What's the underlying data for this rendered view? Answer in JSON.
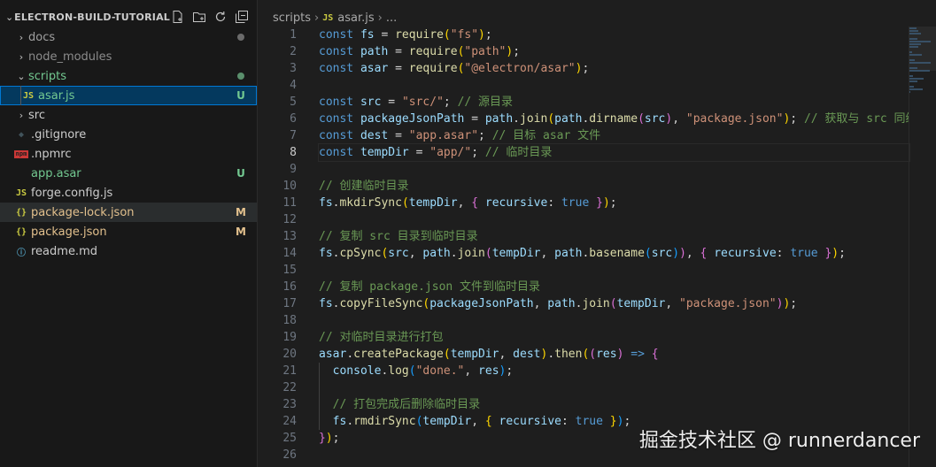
{
  "explorer": {
    "title": "ELECTRON-BUILD-TUTORIAL",
    "actions": [
      "new-file-icon",
      "new-folder-icon",
      "refresh-icon",
      "collapse-all-icon"
    ],
    "items": [
      {
        "label": "docs",
        "kind": "folder",
        "expanded": false,
        "decoration": "dot",
        "color": "#a0a0a0"
      },
      {
        "label": "node_modules",
        "kind": "folder",
        "expanded": false,
        "color": "#8c8c8c"
      },
      {
        "label": "scripts",
        "kind": "folder",
        "expanded": true,
        "decoration": "dot",
        "color": "#73c991"
      },
      {
        "label": "asar.js",
        "kind": "js",
        "badge": "U",
        "color": "#73c991",
        "selected": true
      },
      {
        "label": "src",
        "kind": "folder",
        "expanded": false,
        "color": "#cccccc"
      },
      {
        "label": ".gitignore",
        "kind": "git",
        "color": "#cccccc"
      },
      {
        "label": ".npmrc",
        "kind": "npm",
        "color": "#cccccc"
      },
      {
        "label": "app.asar",
        "kind": "file",
        "badge": "U",
        "color": "#73c991"
      },
      {
        "label": "forge.config.js",
        "kind": "js",
        "color": "#cccccc"
      },
      {
        "label": "package-lock.json",
        "kind": "json",
        "badge": "M",
        "color": "#e2c08d",
        "hover": true
      },
      {
        "label": "package.json",
        "kind": "json",
        "badge": "M",
        "color": "#e2c08d"
      },
      {
        "label": "readme.md",
        "kind": "info",
        "color": "#cccccc"
      }
    ]
  },
  "breadcrumb": {
    "folder": "scripts",
    "file_icon": "JS",
    "file": "asar.js",
    "tail": "..."
  },
  "editor": {
    "active_line": 8,
    "lines": [
      [
        [
          "t-kw",
          "const"
        ],
        [
          "t-p",
          " "
        ],
        [
          "t-var",
          "fs"
        ],
        [
          "t-p",
          " = "
        ],
        [
          "t-fn",
          "require"
        ],
        [
          "t-b1",
          "("
        ],
        [
          "t-str",
          "\"fs\""
        ],
        [
          "t-b1",
          ")"
        ],
        [
          "t-p",
          ";"
        ]
      ],
      [
        [
          "t-kw",
          "const"
        ],
        [
          "t-p",
          " "
        ],
        [
          "t-var",
          "path"
        ],
        [
          "t-p",
          " = "
        ],
        [
          "t-fn",
          "require"
        ],
        [
          "t-b1",
          "("
        ],
        [
          "t-str",
          "\"path\""
        ],
        [
          "t-b1",
          ")"
        ],
        [
          "t-p",
          ";"
        ]
      ],
      [
        [
          "t-kw",
          "const"
        ],
        [
          "t-p",
          " "
        ],
        [
          "t-var",
          "asar"
        ],
        [
          "t-p",
          " = "
        ],
        [
          "t-fn",
          "require"
        ],
        [
          "t-b1",
          "("
        ],
        [
          "t-str",
          "\"@electron/asar\""
        ],
        [
          "t-b1",
          ")"
        ],
        [
          "t-p",
          ";"
        ]
      ],
      [],
      [
        [
          "t-kw",
          "const"
        ],
        [
          "t-p",
          " "
        ],
        [
          "t-var",
          "src"
        ],
        [
          "t-p",
          " = "
        ],
        [
          "t-str",
          "\"src/\""
        ],
        [
          "t-p",
          "; "
        ],
        [
          "t-cm",
          "// 源目录"
        ]
      ],
      [
        [
          "t-kw",
          "const"
        ],
        [
          "t-p",
          " "
        ],
        [
          "t-var",
          "packageJsonPath"
        ],
        [
          "t-p",
          " = "
        ],
        [
          "t-var",
          "path"
        ],
        [
          "t-p",
          "."
        ],
        [
          "t-fn",
          "join"
        ],
        [
          "t-b1",
          "("
        ],
        [
          "t-var",
          "path"
        ],
        [
          "t-p",
          "."
        ],
        [
          "t-fn",
          "dirname"
        ],
        [
          "t-b2",
          "("
        ],
        [
          "t-var",
          "src"
        ],
        [
          "t-b2",
          ")"
        ],
        [
          "t-p",
          ", "
        ],
        [
          "t-str",
          "\"package.json\""
        ],
        [
          "t-b1",
          ")"
        ],
        [
          "t-p",
          "; "
        ],
        [
          "t-cm",
          "// 获取与 src 同级"
        ]
      ],
      [
        [
          "t-kw",
          "const"
        ],
        [
          "t-p",
          " "
        ],
        [
          "t-var",
          "dest"
        ],
        [
          "t-p",
          " = "
        ],
        [
          "t-str",
          "\"app.asar\""
        ],
        [
          "t-p",
          "; "
        ],
        [
          "t-cm",
          "// 目标 asar 文件"
        ]
      ],
      [
        [
          "t-kw",
          "const"
        ],
        [
          "t-p",
          " "
        ],
        [
          "t-var",
          "tempDir"
        ],
        [
          "t-p",
          " = "
        ],
        [
          "t-str",
          "\"app/\""
        ],
        [
          "t-p",
          "; "
        ],
        [
          "t-cm",
          "// 临时目录"
        ]
      ],
      [],
      [
        [
          "t-cm",
          "// 创建临时目录"
        ]
      ],
      [
        [
          "t-var",
          "fs"
        ],
        [
          "t-p",
          "."
        ],
        [
          "t-fn",
          "mkdirSync"
        ],
        [
          "t-b1",
          "("
        ],
        [
          "t-var",
          "tempDir"
        ],
        [
          "t-p",
          ", "
        ],
        [
          "t-b2",
          "{"
        ],
        [
          "t-p",
          " "
        ],
        [
          "t-var",
          "recursive"
        ],
        [
          "t-p",
          ": "
        ],
        [
          "t-bool",
          "true"
        ],
        [
          "t-p",
          " "
        ],
        [
          "t-b2",
          "}"
        ],
        [
          "t-b1",
          ")"
        ],
        [
          "t-p",
          ";"
        ]
      ],
      [],
      [
        [
          "t-cm",
          "// 复制 src 目录到临时目录"
        ]
      ],
      [
        [
          "t-var",
          "fs"
        ],
        [
          "t-p",
          "."
        ],
        [
          "t-fn",
          "cpSync"
        ],
        [
          "t-b1",
          "("
        ],
        [
          "t-var",
          "src"
        ],
        [
          "t-p",
          ", "
        ],
        [
          "t-var",
          "path"
        ],
        [
          "t-p",
          "."
        ],
        [
          "t-fn",
          "join"
        ],
        [
          "t-b2",
          "("
        ],
        [
          "t-var",
          "tempDir"
        ],
        [
          "t-p",
          ", "
        ],
        [
          "t-var",
          "path"
        ],
        [
          "t-p",
          "."
        ],
        [
          "t-fn",
          "basename"
        ],
        [
          "t-b3",
          "("
        ],
        [
          "t-var",
          "src"
        ],
        [
          "t-b3",
          ")"
        ],
        [
          "t-b2",
          ")"
        ],
        [
          "t-p",
          ", "
        ],
        [
          "t-b2",
          "{"
        ],
        [
          "t-p",
          " "
        ],
        [
          "t-var",
          "recursive"
        ],
        [
          "t-p",
          ": "
        ],
        [
          "t-bool",
          "true"
        ],
        [
          "t-p",
          " "
        ],
        [
          "t-b2",
          "}"
        ],
        [
          "t-b1",
          ")"
        ],
        [
          "t-p",
          ";"
        ]
      ],
      [],
      [
        [
          "t-cm",
          "// 复制 package.json 文件到临时目录"
        ]
      ],
      [
        [
          "t-var",
          "fs"
        ],
        [
          "t-p",
          "."
        ],
        [
          "t-fn",
          "copyFileSync"
        ],
        [
          "t-b1",
          "("
        ],
        [
          "t-var",
          "packageJsonPath"
        ],
        [
          "t-p",
          ", "
        ],
        [
          "t-var",
          "path"
        ],
        [
          "t-p",
          "."
        ],
        [
          "t-fn",
          "join"
        ],
        [
          "t-b2",
          "("
        ],
        [
          "t-var",
          "tempDir"
        ],
        [
          "t-p",
          ", "
        ],
        [
          "t-str",
          "\"package.json\""
        ],
        [
          "t-b2",
          ")"
        ],
        [
          "t-b1",
          ")"
        ],
        [
          "t-p",
          ";"
        ]
      ],
      [],
      [
        [
          "t-cm",
          "// 对临时目录进行打包"
        ]
      ],
      [
        [
          "t-var",
          "asar"
        ],
        [
          "t-p",
          "."
        ],
        [
          "t-fn",
          "createPackage"
        ],
        [
          "t-b1",
          "("
        ],
        [
          "t-var",
          "tempDir"
        ],
        [
          "t-p",
          ", "
        ],
        [
          "t-var",
          "dest"
        ],
        [
          "t-b1",
          ")"
        ],
        [
          "t-p",
          "."
        ],
        [
          "t-fn",
          "then"
        ],
        [
          "t-b1",
          "("
        ],
        [
          "t-b2",
          "("
        ],
        [
          "t-var",
          "res"
        ],
        [
          "t-b2",
          ")"
        ],
        [
          "t-p",
          " "
        ],
        [
          "t-kw",
          "=>"
        ],
        [
          "t-p",
          " "
        ],
        [
          "t-b2",
          "{"
        ]
      ],
      [
        [
          "indent",
          ""
        ],
        [
          "t-p",
          " "
        ],
        [
          "t-var",
          "console"
        ],
        [
          "t-p",
          "."
        ],
        [
          "t-fn",
          "log"
        ],
        [
          "t-b3",
          "("
        ],
        [
          "t-str",
          "\"done.\""
        ],
        [
          "t-p",
          ", "
        ],
        [
          "t-var",
          "res"
        ],
        [
          "t-b3",
          ")"
        ],
        [
          "t-p",
          ";"
        ]
      ],
      [
        [
          "indent",
          ""
        ]
      ],
      [
        [
          "indent",
          ""
        ],
        [
          "t-p",
          " "
        ],
        [
          "t-cm",
          "// 打包完成后删除临时目录"
        ]
      ],
      [
        [
          "indent",
          ""
        ],
        [
          "t-p",
          " "
        ],
        [
          "t-var",
          "fs"
        ],
        [
          "t-p",
          "."
        ],
        [
          "t-fn",
          "rmdirSync"
        ],
        [
          "t-b3",
          "("
        ],
        [
          "t-var",
          "tempDir"
        ],
        [
          "t-p",
          ", "
        ],
        [
          "t-b1",
          "{"
        ],
        [
          "t-p",
          " "
        ],
        [
          "t-var",
          "recursive"
        ],
        [
          "t-p",
          ": "
        ],
        [
          "t-bool",
          "true"
        ],
        [
          "t-p",
          " "
        ],
        [
          "t-b1",
          "}"
        ],
        [
          "t-b3",
          ")"
        ],
        [
          "t-p",
          ";"
        ]
      ],
      [
        [
          "t-b2",
          "}"
        ],
        [
          "t-b1",
          ")"
        ],
        [
          "t-p",
          ";"
        ]
      ],
      []
    ]
  },
  "watermark": "掘金技术社区 @ runnerdancer"
}
